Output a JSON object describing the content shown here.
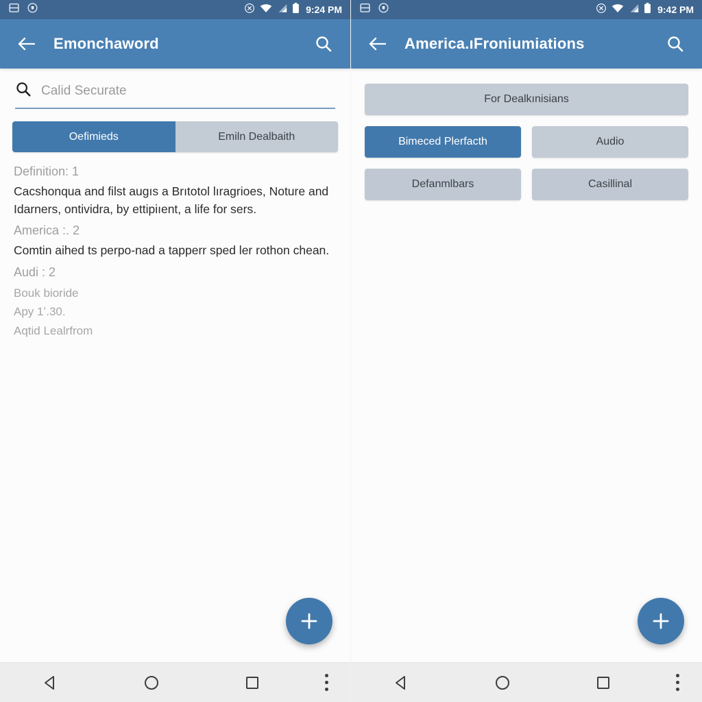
{
  "screens": [
    {
      "id": "left",
      "statusbar": {
        "time": "9:24 PM",
        "icons": [
          "save-storage-icon",
          "circled-info-icon",
          "do-not-disturb-icon",
          "wifi-icon",
          "cellular-signal-icon",
          "battery-icon"
        ]
      },
      "appbar": {
        "back_label": "back-arrow",
        "title": "Emonchaword",
        "search_label": "search"
      },
      "search": {
        "icon": "search-icon",
        "placeholder": "Calid Securate",
        "value": ""
      },
      "tabs": [
        {
          "label": "Oefimieds",
          "active": true
        },
        {
          "label": "Emiln Dealbaith",
          "active": false
        }
      ],
      "definitions": [
        {
          "label": "Definition: 1",
          "body": "Cacshonqua and filst augıs a Brıtotol lıragrioes, Noture and Idarners, ontividra, by ettipiıent, a life for sers.",
          "sub": []
        },
        {
          "label": "America :. 2",
          "body": "Comtin aihed ts perpo-nad a tapperr sped ler rothon chean.",
          "sub": []
        },
        {
          "label": "Audi : 2",
          "body": "",
          "sub": [
            "Bouk bioride",
            "Apy 1ʻ.30.",
            "Aqtid Lealrfrom"
          ]
        }
      ],
      "fab": {
        "label": "+",
        "name": "add-button"
      },
      "navbar": {
        "back": "nav-back-triangle",
        "home": "nav-home-circle",
        "recents": "nav-recents-square",
        "overflow": "nav-overflow-dots"
      }
    },
    {
      "id": "right",
      "statusbar": {
        "time": "9:42 PM",
        "icons": [
          "save-storage-icon",
          "circled-info-icon",
          "do-not-disturb-icon",
          "wifi-icon",
          "cellular-signal-icon",
          "battery-icon"
        ]
      },
      "appbar": {
        "back_label": "back-arrow",
        "title": "America.ıFroniumiations",
        "search_label": "search"
      },
      "chips": [
        [
          {
            "label": "For Dealkınisians",
            "style": "grey",
            "full": true
          }
        ],
        [
          {
            "label": "Bimeced Plerfacth",
            "style": "blue",
            "full": false
          },
          {
            "label": "Audio",
            "style": "grey",
            "full": false
          }
        ],
        [
          {
            "label": "Defanmlbars",
            "style": "grey2",
            "full": false
          },
          {
            "label": "Casillinal",
            "style": "grey2",
            "full": false
          }
        ]
      ],
      "fab": {
        "label": "+",
        "name": "add-button"
      },
      "navbar": {
        "back": "nav-back-triangle",
        "home": "nav-home-circle",
        "recents": "nav-recents-square",
        "overflow": "nav-overflow-dots"
      }
    }
  ],
  "colors": {
    "statusbar": "#3f6690",
    "appbar": "#4a81b4",
    "accent": "#4279ac",
    "chip_grey": "#c3cbd4",
    "background": "#fcfcfc",
    "navbar": "#ededed"
  }
}
